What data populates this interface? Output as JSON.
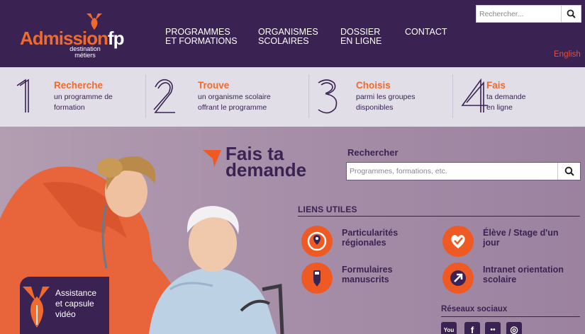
{
  "header": {
    "logo": {
      "main": "Admission",
      "suffix": "fp",
      "sub_line1": "destination",
      "sub_line2": "métiers"
    },
    "nav": [
      {
        "line1": "PROGRAMMES",
        "line2": "ET FORMATIONS"
      },
      {
        "line1": "ORGANISMES",
        "line2": "SCOLAIRES"
      },
      {
        "line1": "DOSSIER",
        "line2": "EN LIGNE"
      },
      {
        "line1": "CONTACT",
        "line2": ""
      }
    ],
    "search_placeholder": "Rechercher...",
    "language": "English"
  },
  "steps": [
    {
      "number": "1",
      "title": "Recherche",
      "desc_line1": "un programme de",
      "desc_line2": "formation"
    },
    {
      "number": "2",
      "title": "Trouve",
      "desc_line1": "un organisme scolaire",
      "desc_line2": "offrant le programme"
    },
    {
      "number": "3",
      "title": "Choisis",
      "desc_line1": "parmi les groupes",
      "desc_line2": "disponibles"
    },
    {
      "number": "4",
      "title": "Fais",
      "desc_line1": "ta demande",
      "desc_line2": "en ligne"
    }
  ],
  "hero": {
    "cta_line1": "Fais ta",
    "cta_line2": "demande",
    "search_label": "Rechercher",
    "search_placeholder": "Programmes, formations, etc.",
    "links_title": "LIENS UTILES",
    "links": [
      {
        "line1": "Particularités",
        "line2": "régionales",
        "icon": "location-pin-icon"
      },
      {
        "line1": "Élève / Stage d'un",
        "line2": "jour",
        "icon": "heart-check-icon"
      },
      {
        "line1": "Formulaires",
        "line2": "manuscrits",
        "icon": "pen-icon"
      },
      {
        "line1": "Intranet orientation",
        "line2": "scolaire",
        "icon": "arrow-icon"
      }
    ],
    "social_title": "Réseaux sociaux",
    "social": [
      {
        "name": "youtube-icon",
        "glyph": "You"
      },
      {
        "name": "facebook-icon",
        "glyph": "f"
      },
      {
        "name": "flickr-icon",
        "glyph": "••"
      },
      {
        "name": "instagram-icon",
        "glyph": "◎"
      }
    ],
    "assist_line1": "Assistance",
    "assist_line2": "et capsule",
    "assist_line3": "vidéo"
  },
  "colors": {
    "purple": "#3a2352",
    "orange": "#ef6a2c",
    "steps_bg": "#e1dee8",
    "hero_bg": "#a790a8"
  }
}
